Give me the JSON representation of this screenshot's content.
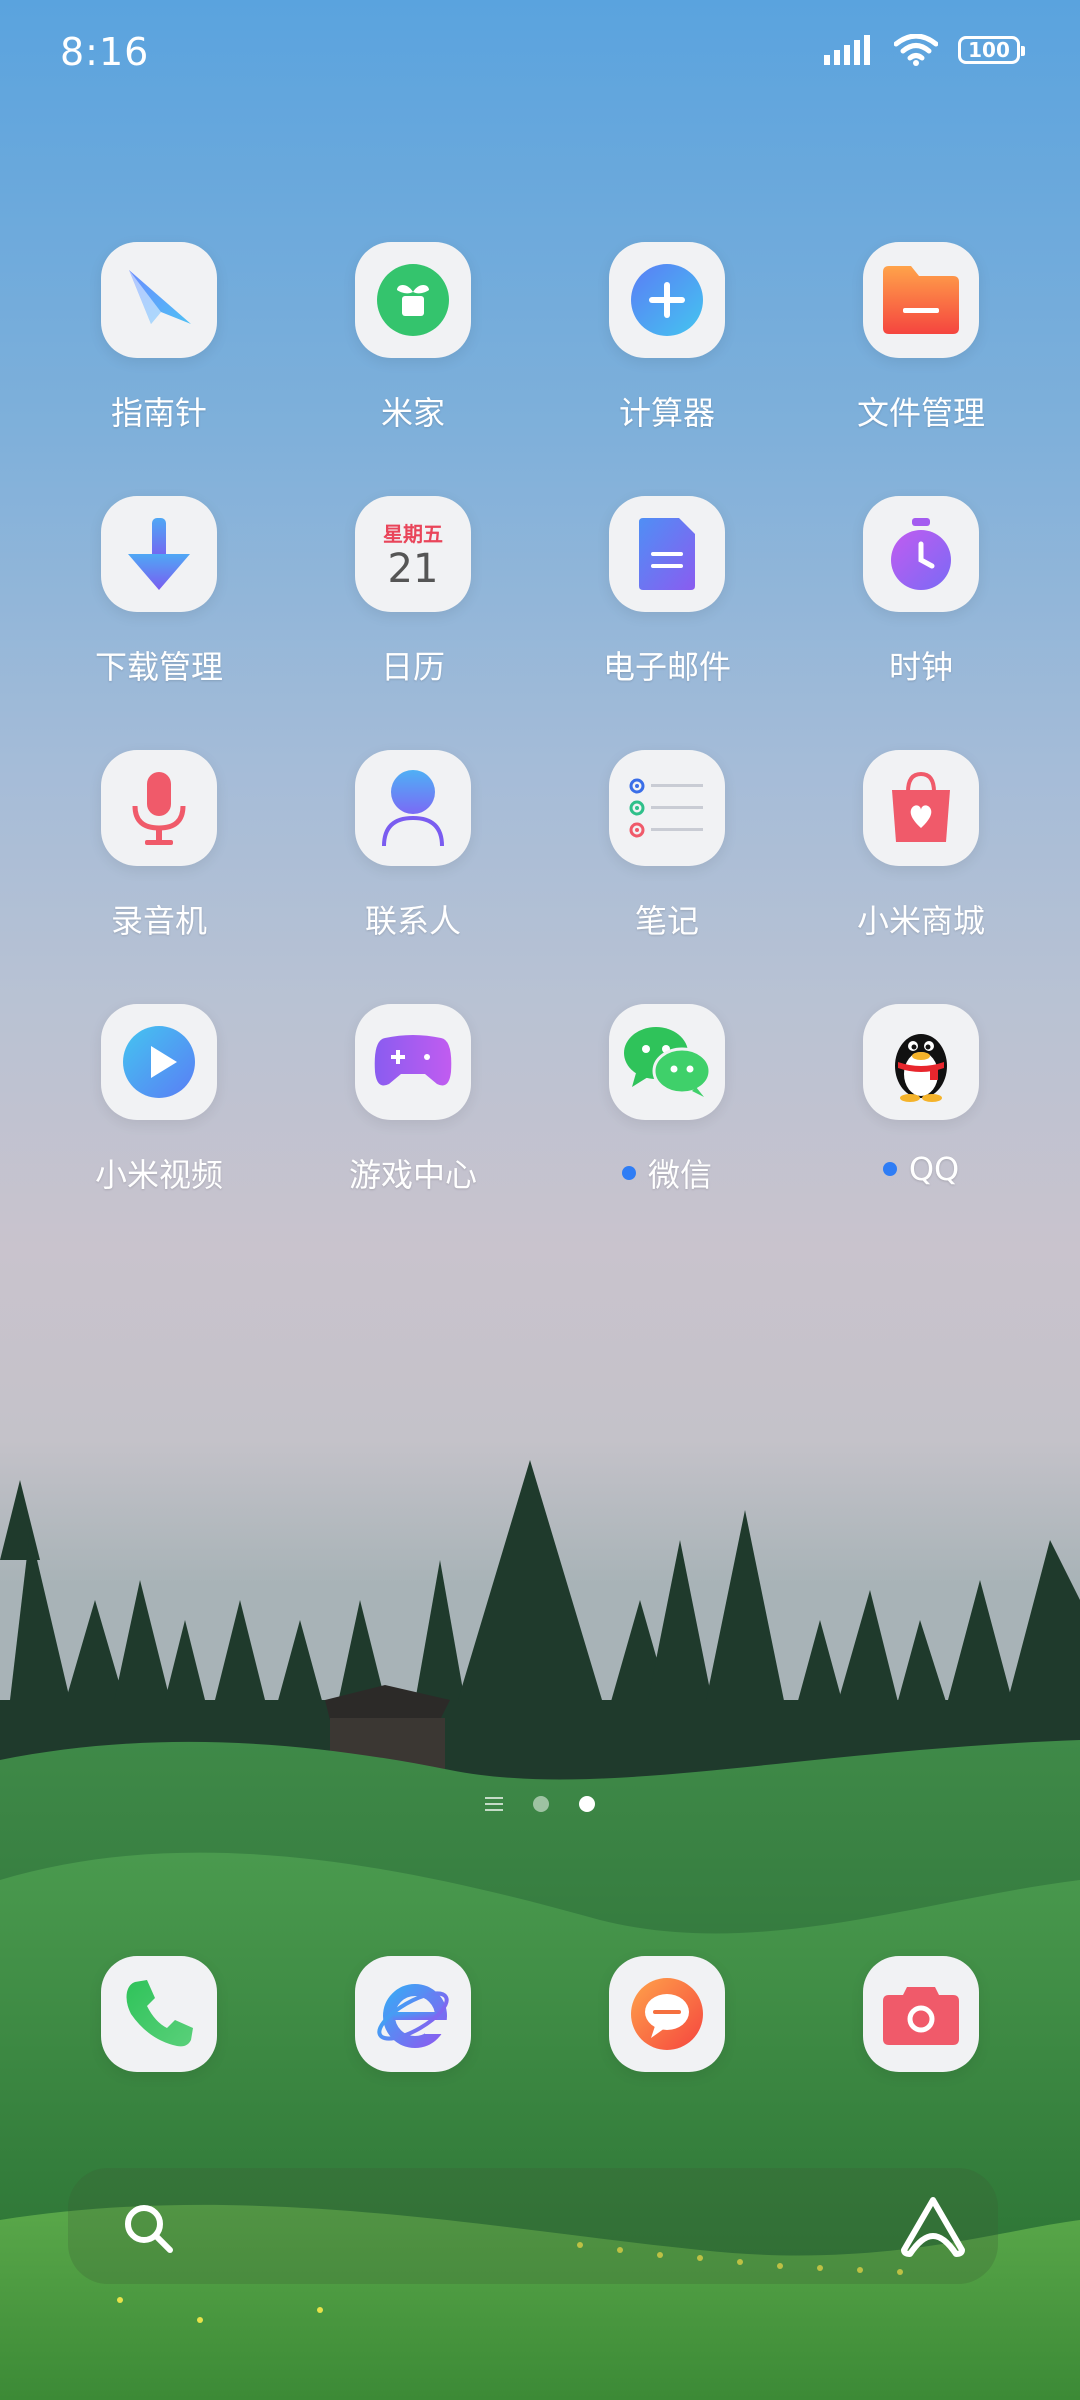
{
  "status_bar": {
    "time": "8:16",
    "battery": "100",
    "icons": [
      "signal-icon",
      "wifi-icon",
      "battery-icon"
    ]
  },
  "apps": [
    [
      {
        "label": "指南针",
        "icon": "compass-icon",
        "notification": false
      },
      {
        "label": "米家",
        "icon": "mijia-icon",
        "notification": false
      },
      {
        "label": "计算器",
        "icon": "calculator-icon",
        "notification": false
      },
      {
        "label": "文件管理",
        "icon": "file-manager-icon",
        "notification": false
      }
    ],
    [
      {
        "label": "下载管理",
        "icon": "download-icon",
        "notification": false
      },
      {
        "label": "日历",
        "icon": "calendar-icon",
        "notification": false,
        "weekday": "星期五",
        "day": "21"
      },
      {
        "label": "电子邮件",
        "icon": "email-icon",
        "notification": false
      },
      {
        "label": "时钟",
        "icon": "clock-icon",
        "notification": false
      }
    ],
    [
      {
        "label": "录音机",
        "icon": "microphone-icon",
        "notification": false
      },
      {
        "label": "联系人",
        "icon": "contacts-icon",
        "notification": false
      },
      {
        "label": "笔记",
        "icon": "notes-icon",
        "notification": false
      },
      {
        "label": "小米商城",
        "icon": "shopping-bag-icon",
        "notification": false
      }
    ],
    [
      {
        "label": "小米视频",
        "icon": "video-play-icon",
        "notification": false
      },
      {
        "label": "游戏中心",
        "icon": "gamepad-icon",
        "notification": false
      },
      {
        "label": "微信",
        "icon": "wechat-icon",
        "notification": true
      },
      {
        "label": "QQ",
        "icon": "qq-penguin-icon",
        "notification": true
      }
    ]
  ],
  "dock": [
    "phone-icon",
    "browser-icon",
    "messages-icon",
    "camera-icon"
  ],
  "pager": {
    "pages": 2,
    "active": 2
  },
  "bottom_bar": [
    "search-icon",
    "assistant-icon"
  ],
  "colors": {
    "notification_dot": "#2f7df5",
    "icon_bg": "#f1f2f4"
  }
}
